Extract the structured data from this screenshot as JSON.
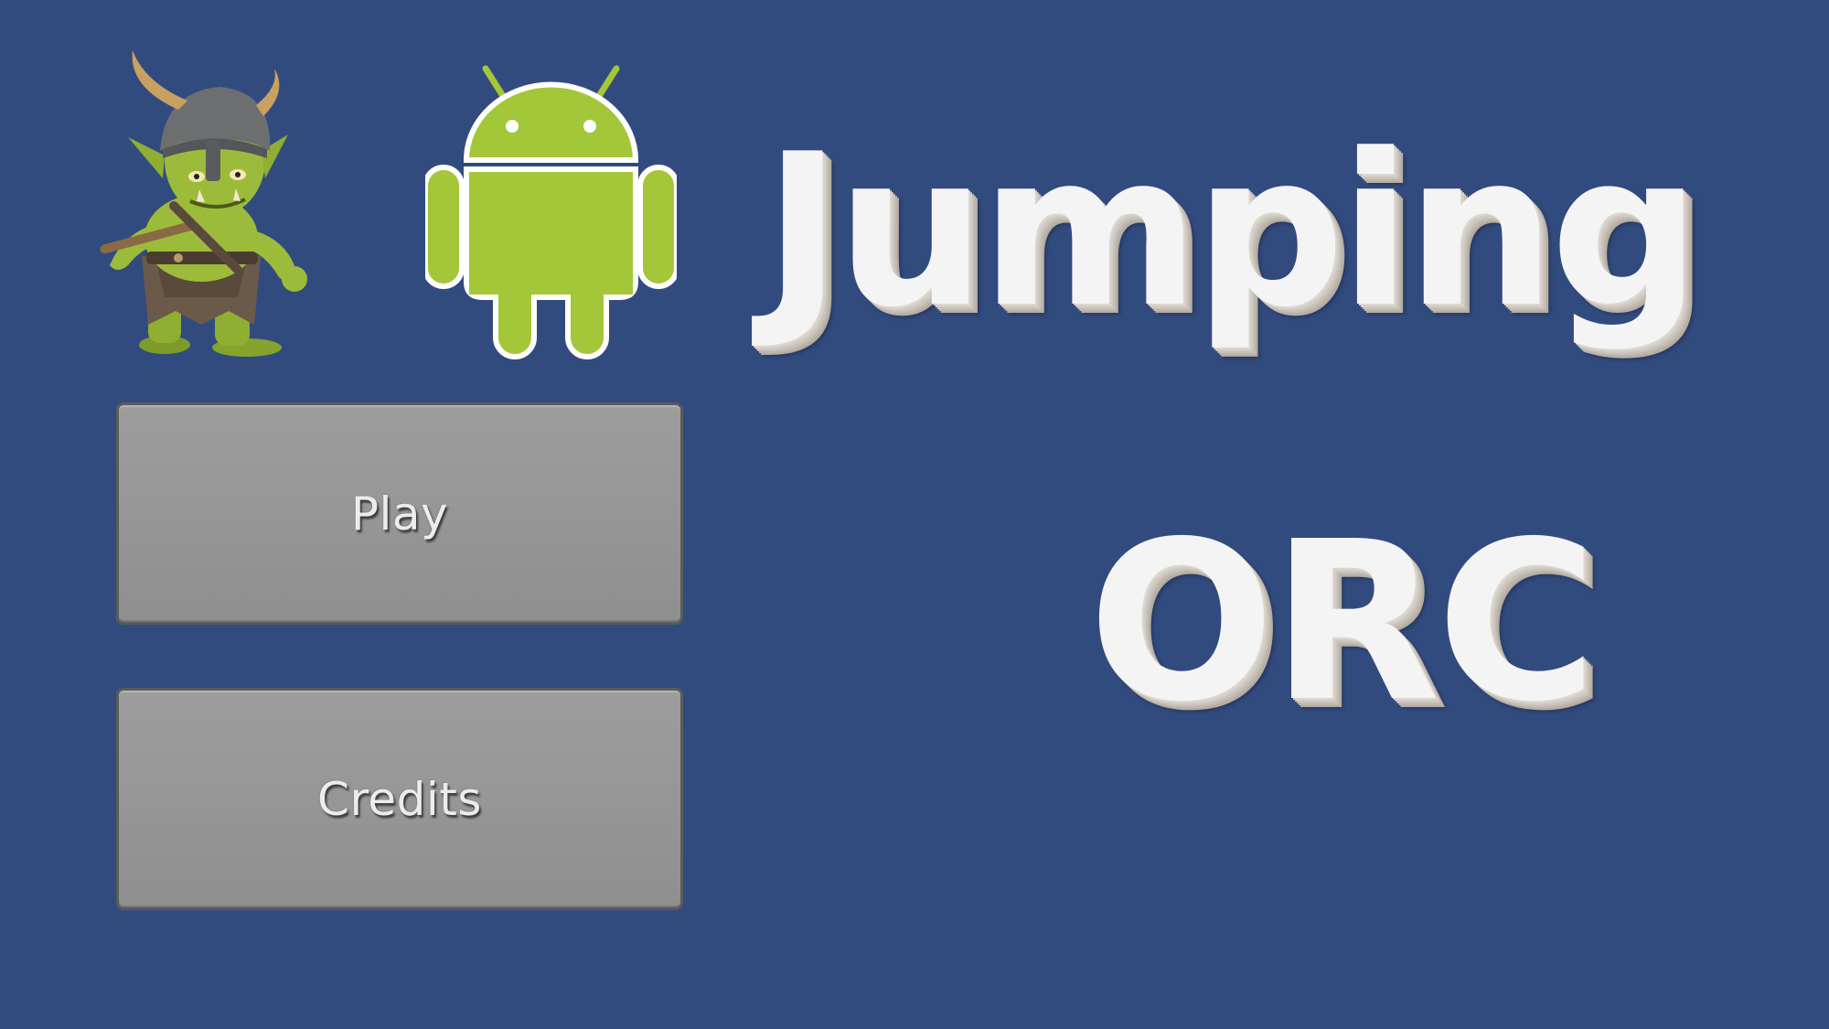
{
  "menu": {
    "buttons": [
      {
        "label": "Play"
      },
      {
        "label": "Credits"
      }
    ]
  },
  "title": {
    "line1": "Jumping",
    "line2": "ORC"
  },
  "icons": {
    "character": "orc-character-icon",
    "platform": "android-logo-icon"
  },
  "colors": {
    "background": "#324b7f",
    "button_face": "#999999",
    "title_text": "#f4f4f4",
    "android_green": "#a4c639"
  }
}
